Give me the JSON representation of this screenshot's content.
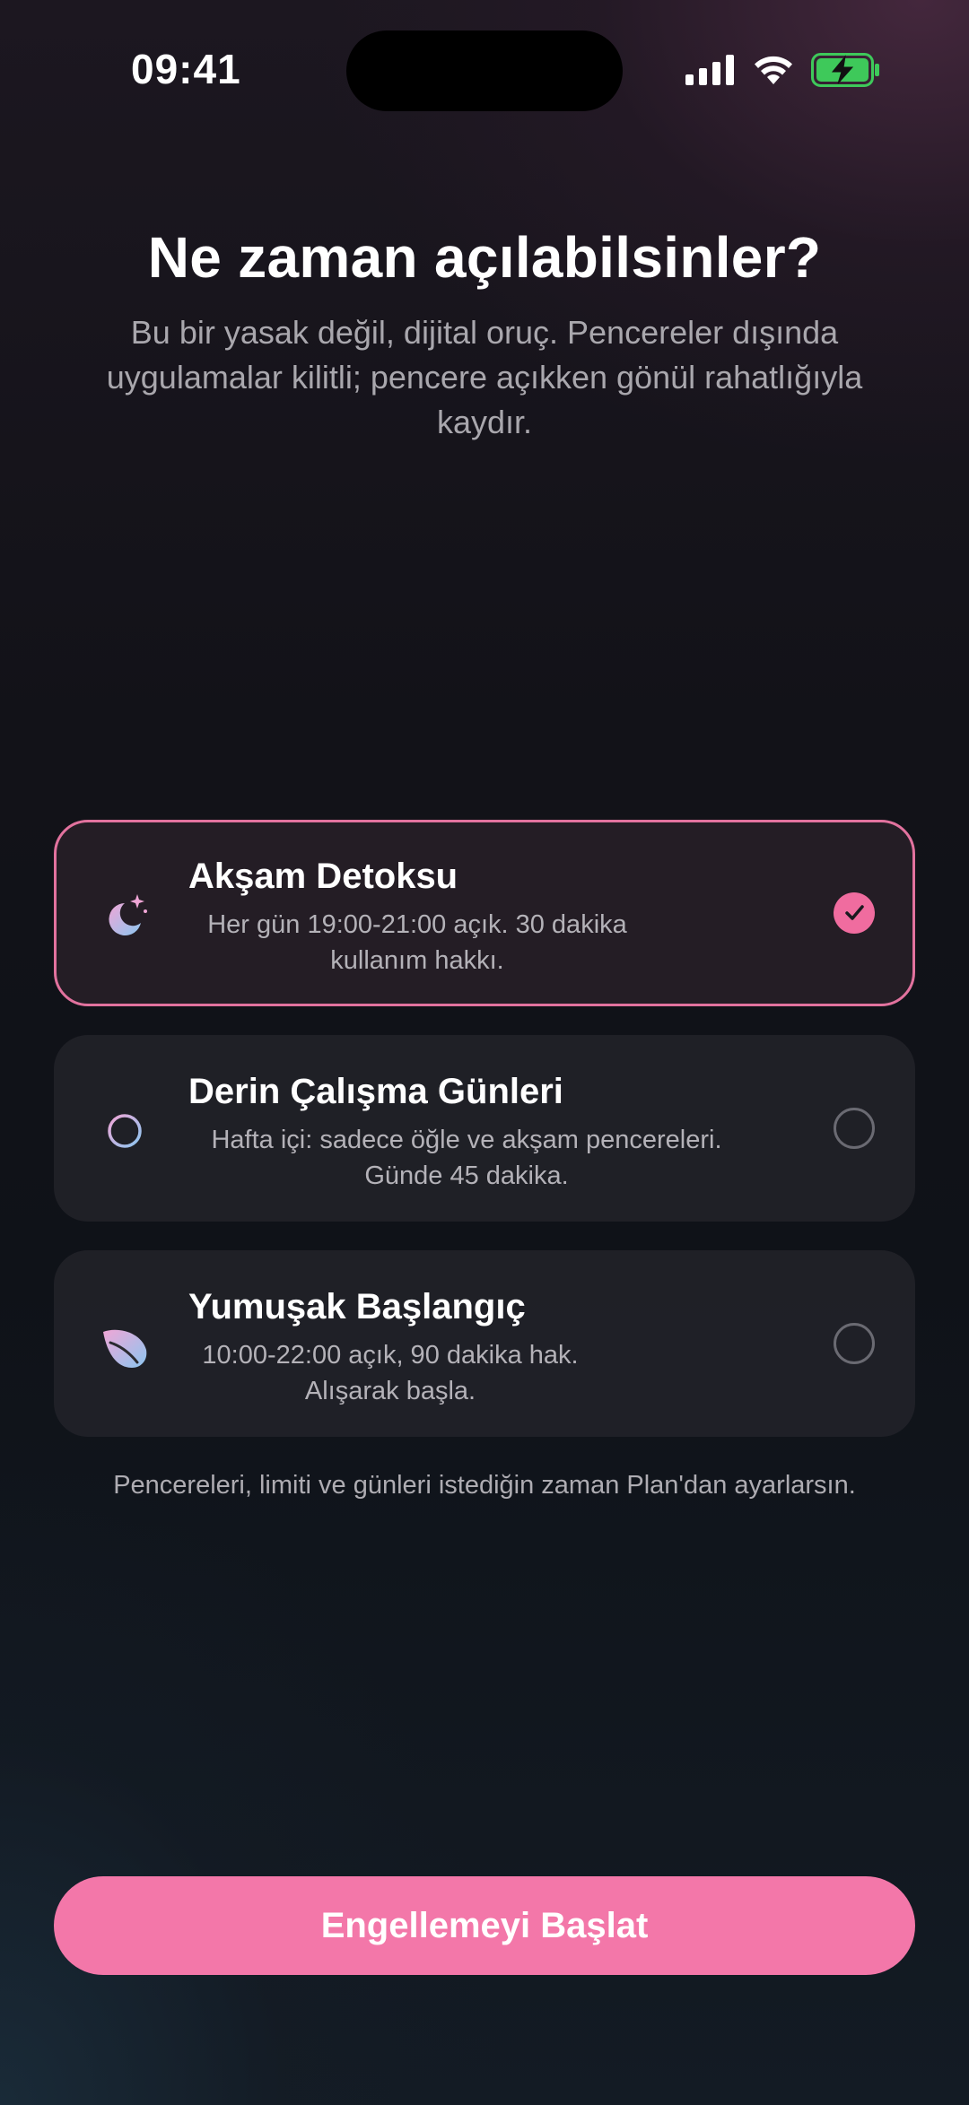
{
  "status_bar": {
    "time": "09:41",
    "icons": [
      "cellular-signal-icon",
      "wifi-icon",
      "battery-charging-icon"
    ],
    "battery_color": "#3ec95a"
  },
  "header": {
    "title": "Ne zaman açılabilsinler?",
    "subtitle": "Bu bir yasak değil, dijital oruç. Pencereler dışında uygulamalar kilitli; pencere açıkken gönül rahatlığıyla kaydır."
  },
  "plans": [
    {
      "icon": "moon-sparkle-icon",
      "title": "Akşam Detoksu",
      "description": "Her gün 19:00-21:00 açık. 30 dakika kullanım hakkı.",
      "selected": true
    },
    {
      "icon": "crosshair-target-icon",
      "title": "Derin Çalışma Günleri",
      "description": "Hafta içi: sadece öğle ve akşam pencereleri. Günde 45 dakika.",
      "selected": false
    },
    {
      "icon": "leaf-icon",
      "title": "Yumuşak Başlangıç",
      "description": "10:00-22:00 açık, 90 dakika hak. Alışarak başla.",
      "selected": false
    }
  ],
  "footnote": "Pencereleri, limiti ve günleri istediğin zaman Plan'dan ayarlarsın.",
  "cta": {
    "label": "Engellemeyi Başlat"
  },
  "colors": {
    "accent": "#f377a9",
    "selected_border": "#e2729e"
  }
}
